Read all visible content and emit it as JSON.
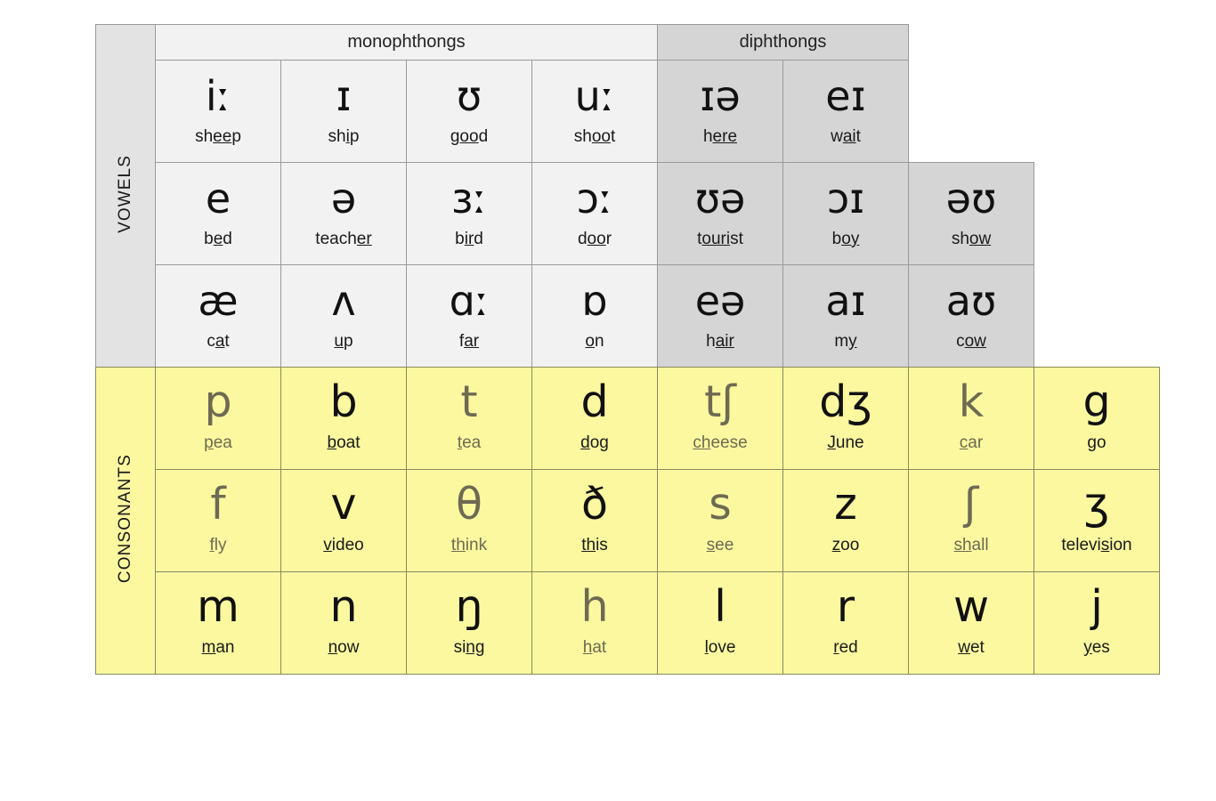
{
  "sections": {
    "vowels_label": "VOWELS",
    "consonants_label": "CONSONANTS"
  },
  "headers": {
    "monophthongs": "monophthongs",
    "diphthongs": "diphthongs"
  },
  "colors": {
    "monophthong_bg": "#f2f2f2",
    "diphthong_bg": "#d5d5d5",
    "consonant_bg": "#fbf8a0",
    "vowel_label_bg": "#e3e3e3",
    "voiceless_text": "#6e6a52",
    "voiced_text": "#111111",
    "border": "#9a9a9a"
  },
  "vowels": {
    "row1": [
      {
        "symbol": "iː",
        "word_pre": "sh",
        "word_mark": "ee",
        "word_post": "p",
        "group": "mono"
      },
      {
        "symbol": "ɪ",
        "word_pre": "sh",
        "word_mark": "i",
        "word_post": "p",
        "group": "mono"
      },
      {
        "symbol": "ʊ",
        "word_pre": "g",
        "word_mark": "oo",
        "word_post": "d",
        "group": "mono"
      },
      {
        "symbol": "uː",
        "word_pre": "sh",
        "word_mark": "oo",
        "word_post": "t",
        "group": "mono"
      },
      {
        "symbol": "ɪə",
        "word_pre": "h",
        "word_mark": "ere",
        "word_post": "",
        "group": "dip"
      },
      {
        "symbol": "eɪ",
        "word_pre": "w",
        "word_mark": "ai",
        "word_post": "t",
        "group": "dip"
      }
    ],
    "row2": [
      {
        "symbol": "e",
        "word_pre": "b",
        "word_mark": "e",
        "word_post": "d",
        "group": "mono"
      },
      {
        "symbol": "ə",
        "word_pre": "teach",
        "word_mark": "er",
        "word_post": "",
        "group": "mono"
      },
      {
        "symbol": "ɜː",
        "word_pre": "b",
        "word_mark": "ir",
        "word_post": "d",
        "group": "mono"
      },
      {
        "symbol": "ɔː",
        "word_pre": "d",
        "word_mark": "oo",
        "word_post": "r",
        "group": "mono"
      },
      {
        "symbol": "ʊə",
        "word_pre": "t",
        "word_mark": "ouri",
        "word_post": "st",
        "group": "dip"
      },
      {
        "symbol": "ɔɪ",
        "word_pre": "b",
        "word_mark": "oy",
        "word_post": "",
        "group": "dip"
      },
      {
        "symbol": "əʊ",
        "word_pre": "sh",
        "word_mark": "ow",
        "word_post": "",
        "group": "dip"
      }
    ],
    "row3": [
      {
        "symbol": "æ",
        "word_pre": "c",
        "word_mark": "a",
        "word_post": "t",
        "group": "mono"
      },
      {
        "symbol": "ʌ",
        "word_pre": "",
        "word_mark": "u",
        "word_post": "p",
        "group": "mono"
      },
      {
        "symbol": "ɑː",
        "word_pre": "f",
        "word_mark": "ar",
        "word_post": "",
        "group": "mono"
      },
      {
        "symbol": "ɒ",
        "word_pre": "",
        "word_mark": "o",
        "word_post": "n",
        "group": "mono"
      },
      {
        "symbol": "eə",
        "word_pre": "h",
        "word_mark": "air",
        "word_post": "",
        "group": "dip"
      },
      {
        "symbol": "aɪ",
        "word_pre": "m",
        "word_mark": "y",
        "word_post": "",
        "group": "dip"
      },
      {
        "symbol": "aʊ",
        "word_pre": "c",
        "word_mark": "ow",
        "word_post": "",
        "group": "dip"
      }
    ]
  },
  "consonants": {
    "row1": [
      {
        "symbol": "p",
        "word_pre": "",
        "word_mark": "p",
        "word_post": "ea",
        "voiced": false
      },
      {
        "symbol": "b",
        "word_pre": "",
        "word_mark": "b",
        "word_post": "oat",
        "voiced": true
      },
      {
        "symbol": "t",
        "word_pre": "",
        "word_mark": "t",
        "word_post": "ea",
        "voiced": false
      },
      {
        "symbol": "d",
        "word_pre": "",
        "word_mark": "d",
        "word_post": "og",
        "voiced": true
      },
      {
        "symbol": "tʃ",
        "word_pre": "",
        "word_mark": "ch",
        "word_post": "eese",
        "voiced": false
      },
      {
        "symbol": "dʒ",
        "word_pre": "",
        "word_mark": "J",
        "word_post": "une",
        "voiced": true
      },
      {
        "symbol": "k",
        "word_pre": "",
        "word_mark": "c",
        "word_post": "ar",
        "voiced": false
      },
      {
        "symbol": "g",
        "word_pre": "",
        "word_mark": "g",
        "word_post": "o",
        "voiced": true
      }
    ],
    "row2": [
      {
        "symbol": "f",
        "word_pre": "",
        "word_mark": "f",
        "word_post": "ly",
        "voiced": false
      },
      {
        "symbol": "v",
        "word_pre": "",
        "word_mark": "v",
        "word_post": "ideo",
        "voiced": true
      },
      {
        "symbol": "θ",
        "word_pre": "",
        "word_mark": "th",
        "word_post": "ink",
        "voiced": false
      },
      {
        "symbol": "ð",
        "word_pre": "",
        "word_mark": "th",
        "word_post": "is",
        "voiced": true
      },
      {
        "symbol": "s",
        "word_pre": "",
        "word_mark": "s",
        "word_post": "ee",
        "voiced": false
      },
      {
        "symbol": "z",
        "word_pre": "",
        "word_mark": "z",
        "word_post": "oo",
        "voiced": true
      },
      {
        "symbol": "ʃ",
        "word_pre": "",
        "word_mark": "sh",
        "word_post": "all",
        "voiced": false
      },
      {
        "symbol": "ʒ",
        "word_pre": "televi",
        "word_mark": "s",
        "word_post": "ion",
        "voiced": true
      }
    ],
    "row3": [
      {
        "symbol": "m",
        "word_pre": "",
        "word_mark": "m",
        "word_post": "an",
        "voiced": true
      },
      {
        "symbol": "n",
        "word_pre": "",
        "word_mark": "n",
        "word_post": "ow",
        "voiced": true
      },
      {
        "symbol": "ŋ",
        "word_pre": "si",
        "word_mark": "ng",
        "word_post": "",
        "voiced": true
      },
      {
        "symbol": "h",
        "word_pre": "",
        "word_mark": "h",
        "word_post": "at",
        "voiced": false
      },
      {
        "symbol": "l",
        "word_pre": "",
        "word_mark": "l",
        "word_post": "ove",
        "voiced": true
      },
      {
        "symbol": "r",
        "word_pre": "",
        "word_mark": "r",
        "word_post": "ed",
        "voiced": true
      },
      {
        "symbol": "w",
        "word_pre": "",
        "word_mark": "w",
        "word_post": "et",
        "voiced": true
      },
      {
        "symbol": "j",
        "word_pre": "",
        "word_mark": "y",
        "word_post": "es",
        "voiced": true
      }
    ]
  }
}
